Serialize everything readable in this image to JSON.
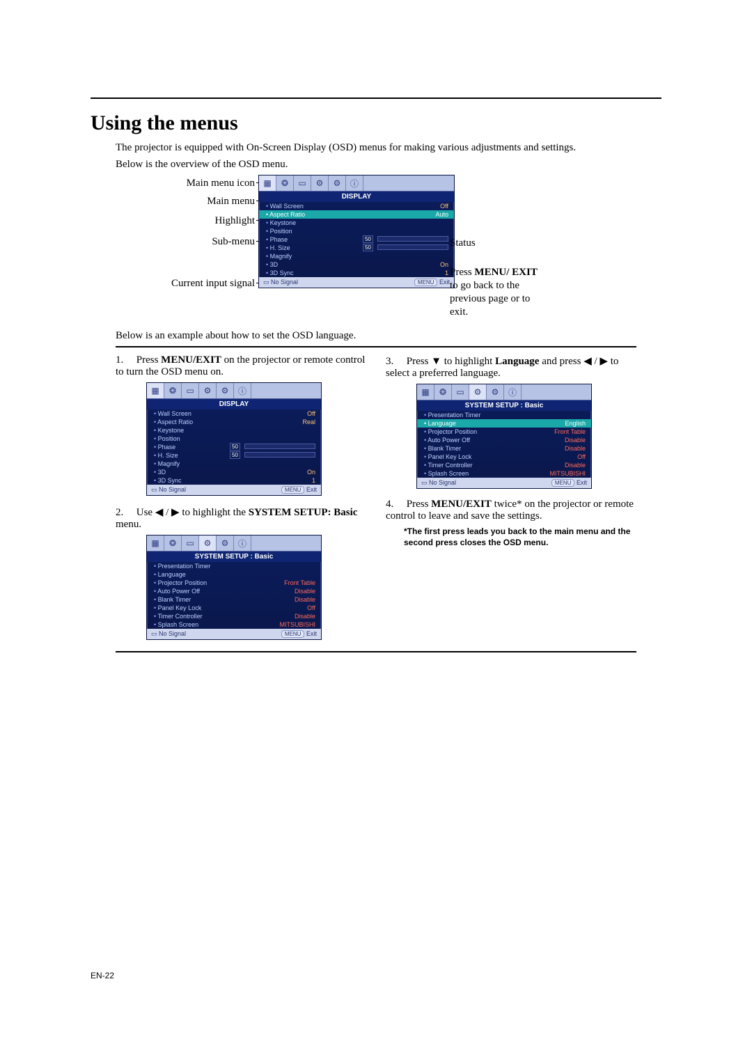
{
  "page": {
    "title": "Using the menus",
    "intro": "The projector is equipped with On-Screen Display (OSD) menus for making various adjustments and settings.",
    "overview_lead": "Below is the overview of the OSD menu.",
    "example_lead": "Below is an example about how to set the OSD language.",
    "footer": "EN-22"
  },
  "annot": {
    "main_menu_icon": "Main menu icon",
    "main_menu": "Main menu",
    "highlight": "Highlight",
    "sub_menu": "Sub-menu",
    "current_input_signal": "Current input signal",
    "status": "Status",
    "press_html": "Press <b>MENU/ EXIT</b> to go back to the previous page or to exit."
  },
  "osd_display": {
    "title": "DISPLAY",
    "rows": [
      {
        "label": "Wall Screen",
        "value": "Off",
        "hi": false
      },
      {
        "label": "Aspect Ratio",
        "value": "Auto",
        "hi": true
      },
      {
        "label": "Keystone",
        "value": "",
        "hi": false
      },
      {
        "label": "Position",
        "value": "",
        "hi": false
      },
      {
        "label": "Phase",
        "value": "50",
        "bar": true,
        "hi": false
      },
      {
        "label": "H. Size",
        "value": "50",
        "bar": true,
        "hi": false
      },
      {
        "label": "Magnify",
        "value": "",
        "hi": false
      },
      {
        "label": "3D",
        "value": "On",
        "hi": false
      },
      {
        "label": "3D Sync",
        "value": "1",
        "hi": false
      }
    ],
    "footer_signal": "No Signal",
    "footer_menu": "MENU",
    "footer_exit": "Exit"
  },
  "osd_display_step1": {
    "title": "DISPLAY",
    "rows": [
      {
        "label": "Wall Screen",
        "value": "Off"
      },
      {
        "label": "Aspect Ratio",
        "value": "Real"
      },
      {
        "label": "Keystone",
        "value": ""
      },
      {
        "label": "Position",
        "value": ""
      },
      {
        "label": "Phase",
        "value": "50",
        "bar": true
      },
      {
        "label": "H. Size",
        "value": "50",
        "bar": true
      },
      {
        "label": "Magnify",
        "value": ""
      },
      {
        "label": "3D",
        "value": "On"
      },
      {
        "label": "3D Sync",
        "value": "1"
      }
    ],
    "footer_signal": "No Signal",
    "footer_menu": "MENU",
    "footer_exit": "Exit"
  },
  "osd_system": {
    "title": "SYSTEM SETUP : Basic",
    "rows": [
      {
        "label": "Presentation Timer",
        "value": ""
      },
      {
        "label": "Language",
        "value": ""
      },
      {
        "label": "Projector Position",
        "value": "Front Table",
        "red": true
      },
      {
        "label": "Auto Power Off",
        "value": "Disable",
        "red": true
      },
      {
        "label": "Blank Timer",
        "value": "Disable",
        "red": true
      },
      {
        "label": "Panel Key Lock",
        "value": "Off",
        "red": true
      },
      {
        "label": "Timer Controller",
        "value": "Disable",
        "red": true
      },
      {
        "label": "Splash Screen",
        "value": "MITSUBISHI",
        "red": true
      }
    ],
    "footer_signal": "No Signal",
    "footer_menu": "MENU",
    "footer_exit": "Exit"
  },
  "osd_system_step3": {
    "title": "SYSTEM SETUP : Basic",
    "rows": [
      {
        "label": "Presentation Timer",
        "value": ""
      },
      {
        "label": "Language",
        "value": "English",
        "hi": true
      },
      {
        "label": "Projector Position",
        "value": "Front Table",
        "red": true
      },
      {
        "label": "Auto Power Off",
        "value": "Disable",
        "red": true
      },
      {
        "label": "Blank Timer",
        "value": "Disable",
        "red": true
      },
      {
        "label": "Panel Key Lock",
        "value": "Off",
        "red": true
      },
      {
        "label": "Timer Controller",
        "value": "Disable",
        "red": true
      },
      {
        "label": "Splash Screen",
        "value": "MITSUBISHI",
        "red": true
      }
    ],
    "footer_signal": "No Signal",
    "footer_menu": "MENU",
    "footer_exit": "Exit"
  },
  "steps": {
    "s1_pre": "Press ",
    "s1_bold": "MENU/EXIT",
    "s1_post": " on the projector or remote control to turn the OSD menu on.",
    "s2_pre": "Use  ◀ / ▶  to highlight the ",
    "s2_bold": "SYSTEM SETUP: Basic",
    "s2_post": " menu.",
    "s3_pre": "Press  ▼  to highlight ",
    "s3_bold": "Language",
    "s3_post": " and press  ◀ / ▶ to select a preferred language.",
    "s4_pre": "Press ",
    "s4_bold": "MENU/EXIT",
    "s4_post": " twice* on the projector or remote control to leave and save the settings.",
    "note": "*The first press leads you back to the main menu and the second press closes the OSD menu."
  }
}
